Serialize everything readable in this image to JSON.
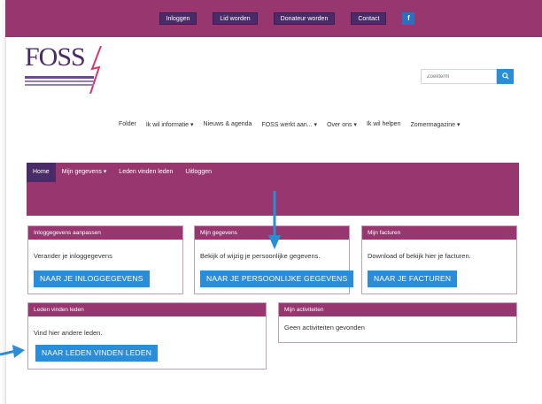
{
  "topbar": {
    "buttons": [
      "Inloggen",
      "Lid worden",
      "Donateur worden",
      "Contact"
    ],
    "facebook": "f"
  },
  "header": {
    "logo_text": "FOSS",
    "search_placeholder": "Zoekterm"
  },
  "mainnav": [
    "Folder",
    "Ik wil informatie ▾",
    "Nieuws & agenda",
    "FOSS werkt aan... ▾",
    "Over ons ▾",
    "Ik wil helpen",
    "Zomermagazine ▾"
  ],
  "subnav": [
    "Home",
    "Mijn gegevens ▾",
    "Leden vinden leden",
    "Uitloggen"
  ],
  "cards": {
    "login": {
      "title": "Inloggegevens aanpassen",
      "text": "Verander je inloggegevens",
      "button": "NAAR JE INLOGGEGEVENS"
    },
    "gegevens": {
      "title": "Mijn gegevens",
      "text": "Bekijk of wijzig je persoonlijke gegevens.",
      "button": "NAAR JE PERSOONLIJKE GEGEVENS"
    },
    "facturen": {
      "title": "Mijn facturen",
      "text": "Download of bekijk hier je facturen.",
      "button": "NAAR JE FACTUREN"
    },
    "leden": {
      "title": "Leden vinden leden",
      "text": "Vind hier andere leden.",
      "button": "NAAR LEDEN VINDEN LEDEN"
    },
    "activiteiten": {
      "title": "Mijn activiteiten",
      "text": "Geen activiteiten gevonden"
    }
  },
  "colors": {
    "purple": "#97366f",
    "dark_purple": "#4a2a67",
    "blue": "#2b8dd8"
  }
}
